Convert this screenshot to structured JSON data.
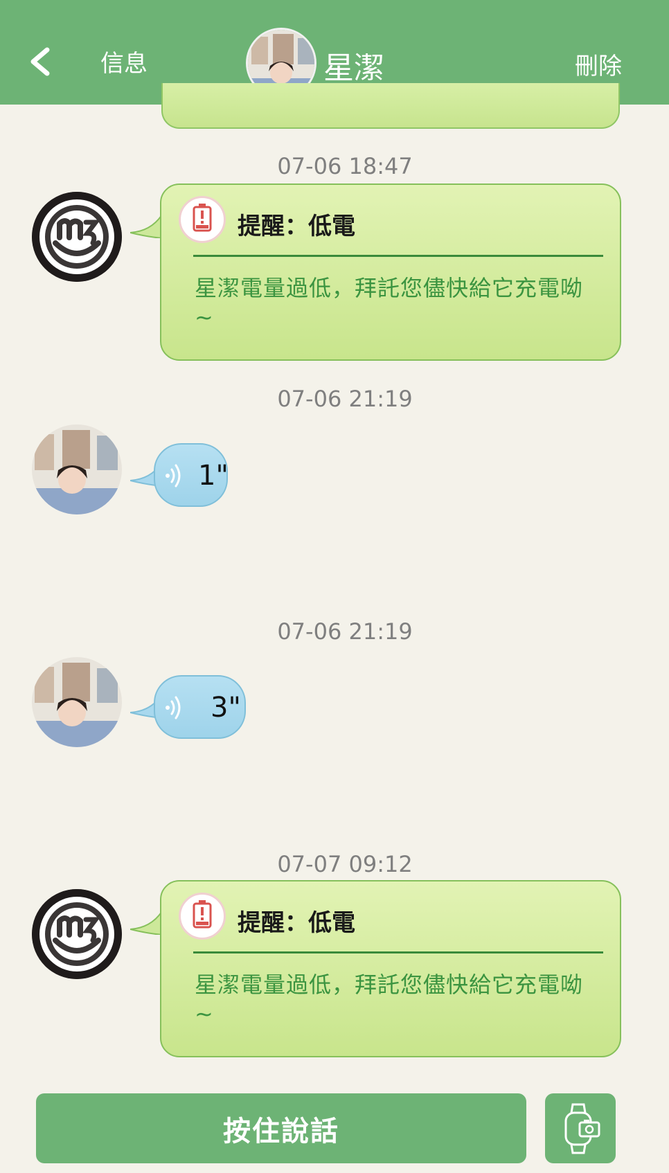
{
  "header": {
    "back_label": "信息",
    "contact_name": "星潔",
    "delete_label": "刪除"
  },
  "messages": [
    {
      "type": "alert",
      "timestamp": "07-06 18:47",
      "title": "提醒：低電",
      "body": "星潔電量過低，拜託您儘快給它充電呦~"
    },
    {
      "type": "voice",
      "timestamp": "07-06 21:19",
      "duration": "1\""
    },
    {
      "type": "voice",
      "timestamp": "07-06 21:19",
      "duration": "3\""
    },
    {
      "type": "alert",
      "timestamp": "07-07 09:12",
      "title": "提醒：低電",
      "body": "星潔電量過低，拜託您儘快給它充電呦~"
    }
  ],
  "footer": {
    "talk_label": "按住說話"
  },
  "colors": {
    "header_bg": "#6db375",
    "alert_bubble": "#c8e58c",
    "voice_bubble": "#a8d8ee",
    "background": "#f4f2ea"
  }
}
